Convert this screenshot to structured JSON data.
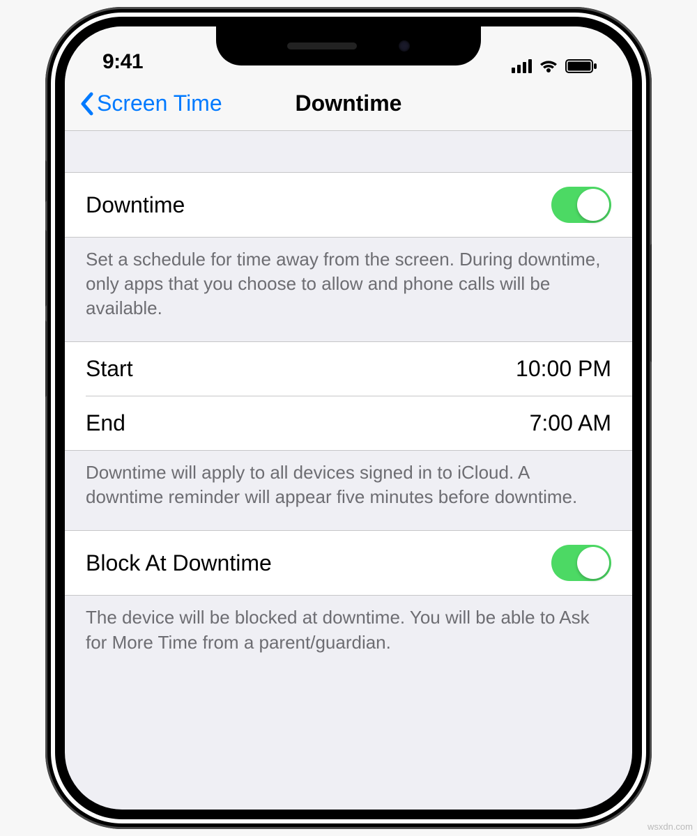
{
  "status": {
    "time": "9:41"
  },
  "nav": {
    "back": "Screen Time",
    "title": "Downtime"
  },
  "downtime": {
    "label": "Downtime",
    "enabled": true,
    "description": "Set a schedule for time away from the screen. During downtime, only apps that you choose to allow and phone calls will be available."
  },
  "schedule": {
    "start_label": "Start",
    "start_value": "10:00 PM",
    "end_label": "End",
    "end_value": "7:00 AM",
    "description": "Downtime will apply to all devices signed in to iCloud. A downtime reminder will appear five minutes before downtime."
  },
  "block": {
    "label": "Block At Downtime",
    "enabled": true,
    "description": "The device will be blocked at downtime. You will be able to Ask for More Time from a parent/guardian."
  },
  "watermark": "wsxdn.com"
}
